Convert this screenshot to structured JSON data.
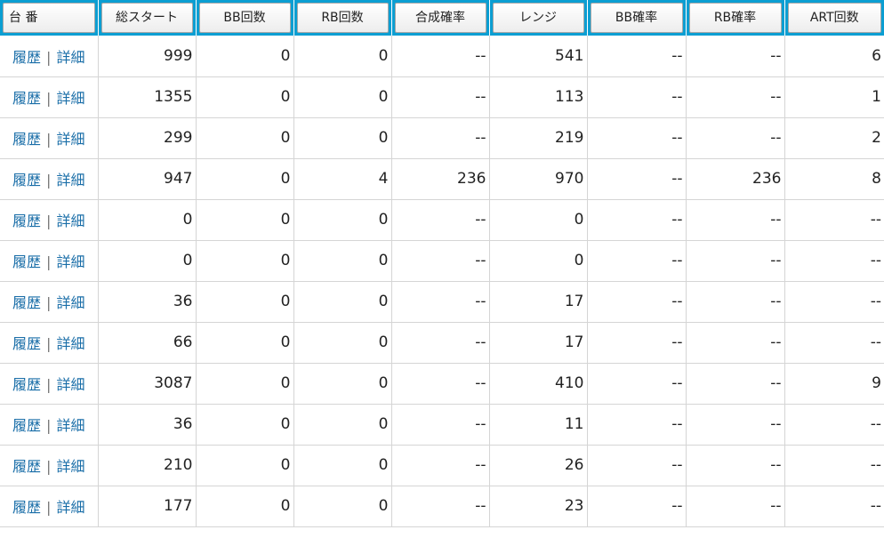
{
  "headers": [
    {
      "label": "台 番",
      "name": "header-dai-ban"
    },
    {
      "label": "総スタート",
      "name": "header-total-start"
    },
    {
      "label": "BB回数",
      "name": "header-bb-count"
    },
    {
      "label": "RB回数",
      "name": "header-rb-count"
    },
    {
      "label": "合成確率",
      "name": "header-combined-prob"
    },
    {
      "label": "レンジ",
      "name": "header-range"
    },
    {
      "label": "BB確率",
      "name": "header-bb-prob"
    },
    {
      "label": "RB確率",
      "name": "header-rb-prob"
    },
    {
      "label": "ART回数",
      "name": "header-art-count"
    }
  ],
  "link_labels": {
    "history": "履歴",
    "separator": "|",
    "detail": "詳細"
  },
  "rows": [
    [
      "999",
      "0",
      "0",
      "--",
      "541",
      "--",
      "--",
      "6"
    ],
    [
      "1355",
      "0",
      "0",
      "--",
      "113",
      "--",
      "--",
      "1"
    ],
    [
      "299",
      "0",
      "0",
      "--",
      "219",
      "--",
      "--",
      "2"
    ],
    [
      "947",
      "0",
      "4",
      "236",
      "970",
      "--",
      "236",
      "8"
    ],
    [
      "0",
      "0",
      "0",
      "--",
      "0",
      "--",
      "--",
      "--"
    ],
    [
      "0",
      "0",
      "0",
      "--",
      "0",
      "--",
      "--",
      "--"
    ],
    [
      "36",
      "0",
      "0",
      "--",
      "17",
      "--",
      "--",
      "--"
    ],
    [
      "66",
      "0",
      "0",
      "--",
      "17",
      "--",
      "--",
      "--"
    ],
    [
      "3087",
      "0",
      "0",
      "--",
      "410",
      "--",
      "--",
      "9"
    ],
    [
      "36",
      "0",
      "0",
      "--",
      "11",
      "--",
      "--",
      "--"
    ],
    [
      "210",
      "0",
      "0",
      "--",
      "26",
      "--",
      "--",
      "--"
    ],
    [
      "177",
      "0",
      "0",
      "--",
      "23",
      "--",
      "--",
      "--"
    ]
  ],
  "colors": {
    "header_bg": "#0b9ed2",
    "link": "#1a6ea8",
    "grid": "#d5d5d5"
  }
}
